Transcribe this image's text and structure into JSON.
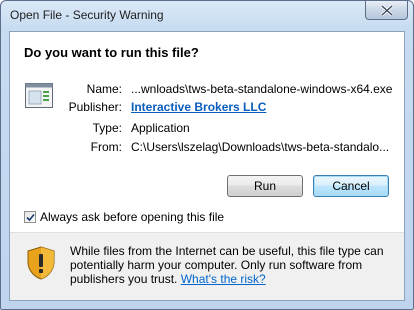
{
  "window": {
    "title": "Open File - Security Warning"
  },
  "dialog": {
    "question": "Do you want to run this file?",
    "fields": [
      {
        "label": "Name:",
        "value": "...wnloads\\tws-beta-standalone-windows-x64.exe"
      },
      {
        "label": "Publisher:",
        "value": "Interactive Brokers LLC"
      },
      {
        "label": "Type:",
        "value": "Application"
      },
      {
        "label": "From:",
        "value": "C:\\Users\\lszelag\\Downloads\\tws-beta-standalo..."
      }
    ],
    "buttons": {
      "run": "Run",
      "cancel": "Cancel"
    },
    "checkbox": {
      "label": "Always ask before opening this file",
      "checked": true
    },
    "warning": {
      "text": "While files from the Internet can be useful, this file type can potentially harm your computer. Only run software from publishers you trust.",
      "link": "What's the risk?"
    }
  },
  "colors": {
    "link": "#0066cc",
    "publisher_link": "#0a5dbd"
  },
  "icons": {
    "close": "close-icon",
    "file": "application-file-icon",
    "shield": "security-shield-icon",
    "check": "checkmark-icon"
  }
}
